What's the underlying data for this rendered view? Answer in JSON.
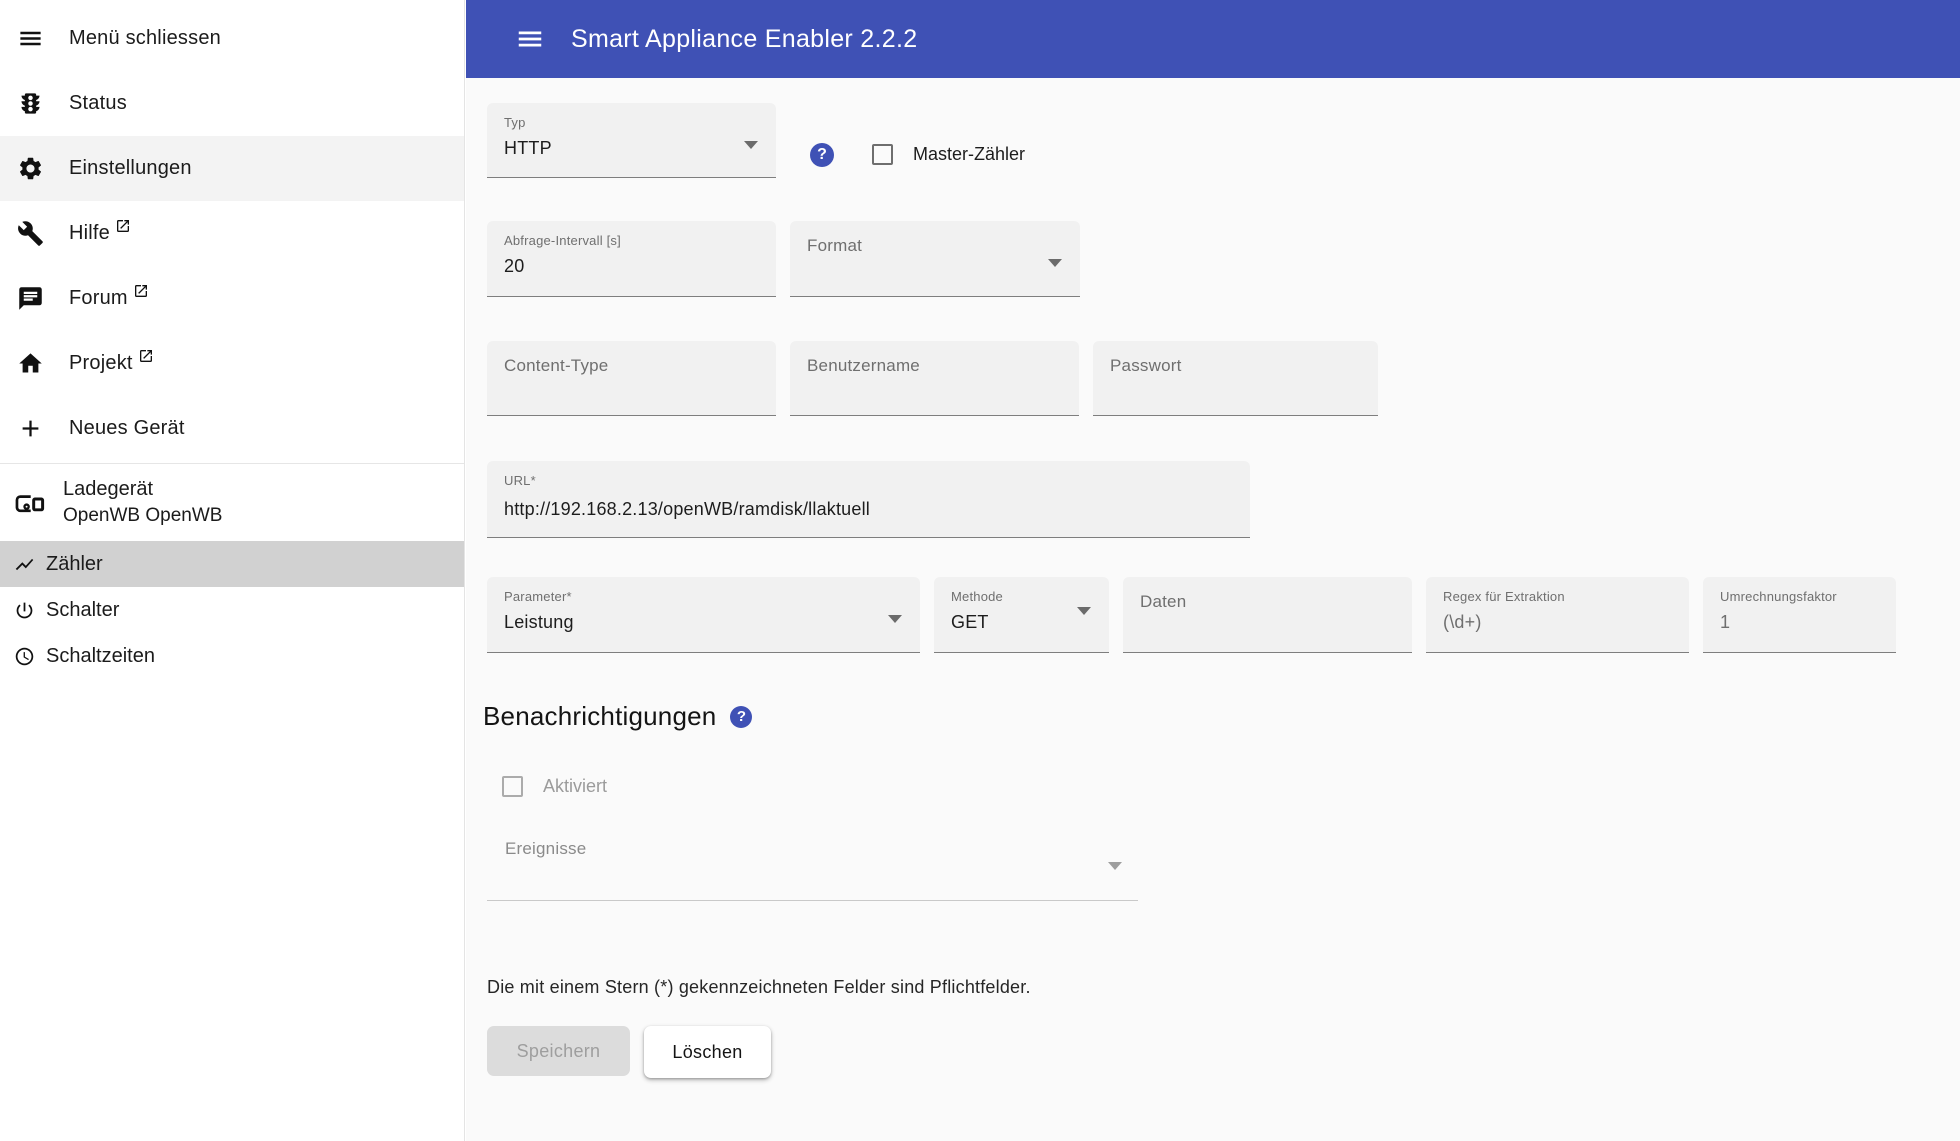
{
  "app": {
    "title": "Smart Appliance Enabler 2.2.2"
  },
  "sidebar": {
    "items": [
      {
        "label": "Menü schliessen",
        "icon": "menu-icon"
      },
      {
        "label": "Status",
        "icon": "traffic-light-icon"
      },
      {
        "label": "Einstellungen",
        "icon": "gear-icon",
        "active": true
      },
      {
        "label": "Hilfe",
        "icon": "wrench-icon",
        "external": true
      },
      {
        "label": "Forum",
        "icon": "chat-icon",
        "external": true
      },
      {
        "label": "Projekt",
        "icon": "home-icon",
        "external": true
      },
      {
        "label": "Neues Gerät",
        "icon": "plus-icon"
      }
    ],
    "device": {
      "title": "Ladegerät",
      "subtitle": "OpenWB OpenWB"
    },
    "device_items": [
      {
        "label": "Zähler",
        "icon": "chart-line-icon",
        "selected": true
      },
      {
        "label": "Schalter",
        "icon": "power-icon",
        "selected": false
      },
      {
        "label": "Schaltzeiten",
        "icon": "clock-icon",
        "selected": false
      }
    ]
  },
  "form": {
    "typ": {
      "label": "Typ",
      "value": "HTTP"
    },
    "master_zaehler": {
      "label": "Master-Zähler",
      "checked": false
    },
    "abfrage_intervall": {
      "label": "Abfrage-Intervall [s]",
      "value": "20"
    },
    "format": {
      "label": "Format",
      "value": ""
    },
    "content_type": {
      "label": "Content-Type",
      "value": ""
    },
    "benutzername": {
      "label": "Benutzername",
      "value": ""
    },
    "passwort": {
      "label": "Passwort",
      "value": ""
    },
    "url": {
      "label": "URL*",
      "value": "http://192.168.2.13/openWB/ramdisk/llaktuell"
    },
    "parameter": {
      "label": "Parameter*",
      "value": "Leistung"
    },
    "methode": {
      "label": "Methode",
      "value": "GET"
    },
    "daten": {
      "label": "Daten",
      "value": ""
    },
    "regex": {
      "label": "Regex für Extraktion",
      "value": "(\\d+)"
    },
    "umrechnungsfaktor": {
      "label": "Umrechnungsfaktor",
      "value": "1"
    }
  },
  "notifications": {
    "heading": "Benachrichtigungen",
    "aktiviert_label": "Aktiviert",
    "ereignisse_label": "Ereignisse"
  },
  "footer": {
    "required_note": "Die mit einem Stern (*) gekennzeichneten Felder sind Pflichtfelder.",
    "save_label": "Speichern",
    "delete_label": "Löschen"
  },
  "colors": {
    "appbar": "#3f51b5",
    "help_icon": "#3f51b5",
    "selected_item_bg": "#d1d1d1",
    "active_item_bg": "#f3f3f3",
    "field_bg": "#f1f1f1",
    "content_bg": "#fafafa"
  }
}
